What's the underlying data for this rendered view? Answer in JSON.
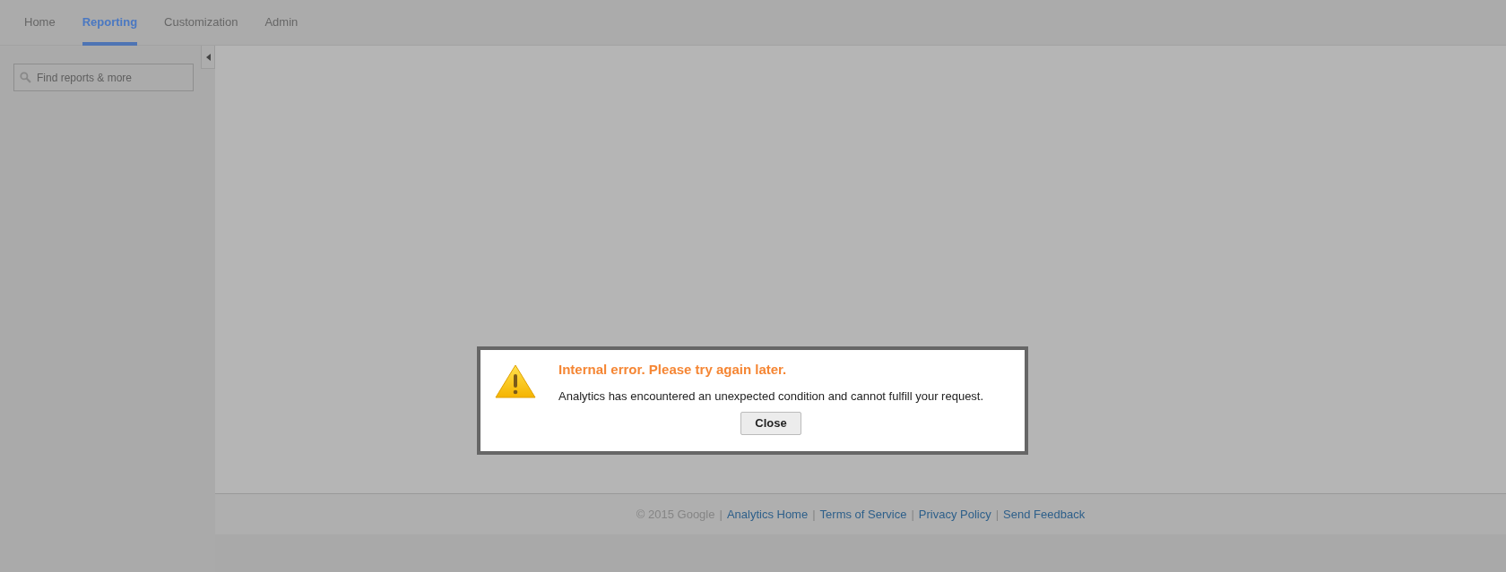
{
  "tabs": [
    {
      "label": "Home",
      "selected": false
    },
    {
      "label": "Reporting",
      "selected": true
    },
    {
      "label": "Customization",
      "selected": false
    },
    {
      "label": "Admin",
      "selected": false
    }
  ],
  "search": {
    "placeholder": "Find reports & more"
  },
  "dialog": {
    "title": "Internal error. Please try again later.",
    "message": "Analytics has encountered an unexpected condition and cannot fulfill your request.",
    "button": "Close"
  },
  "footer": {
    "copyright": "© 2015 Google",
    "separator": "|",
    "links": [
      "Analytics Home",
      "Terms of Service",
      "Privacy Policy",
      "Send Feedback"
    ]
  }
}
